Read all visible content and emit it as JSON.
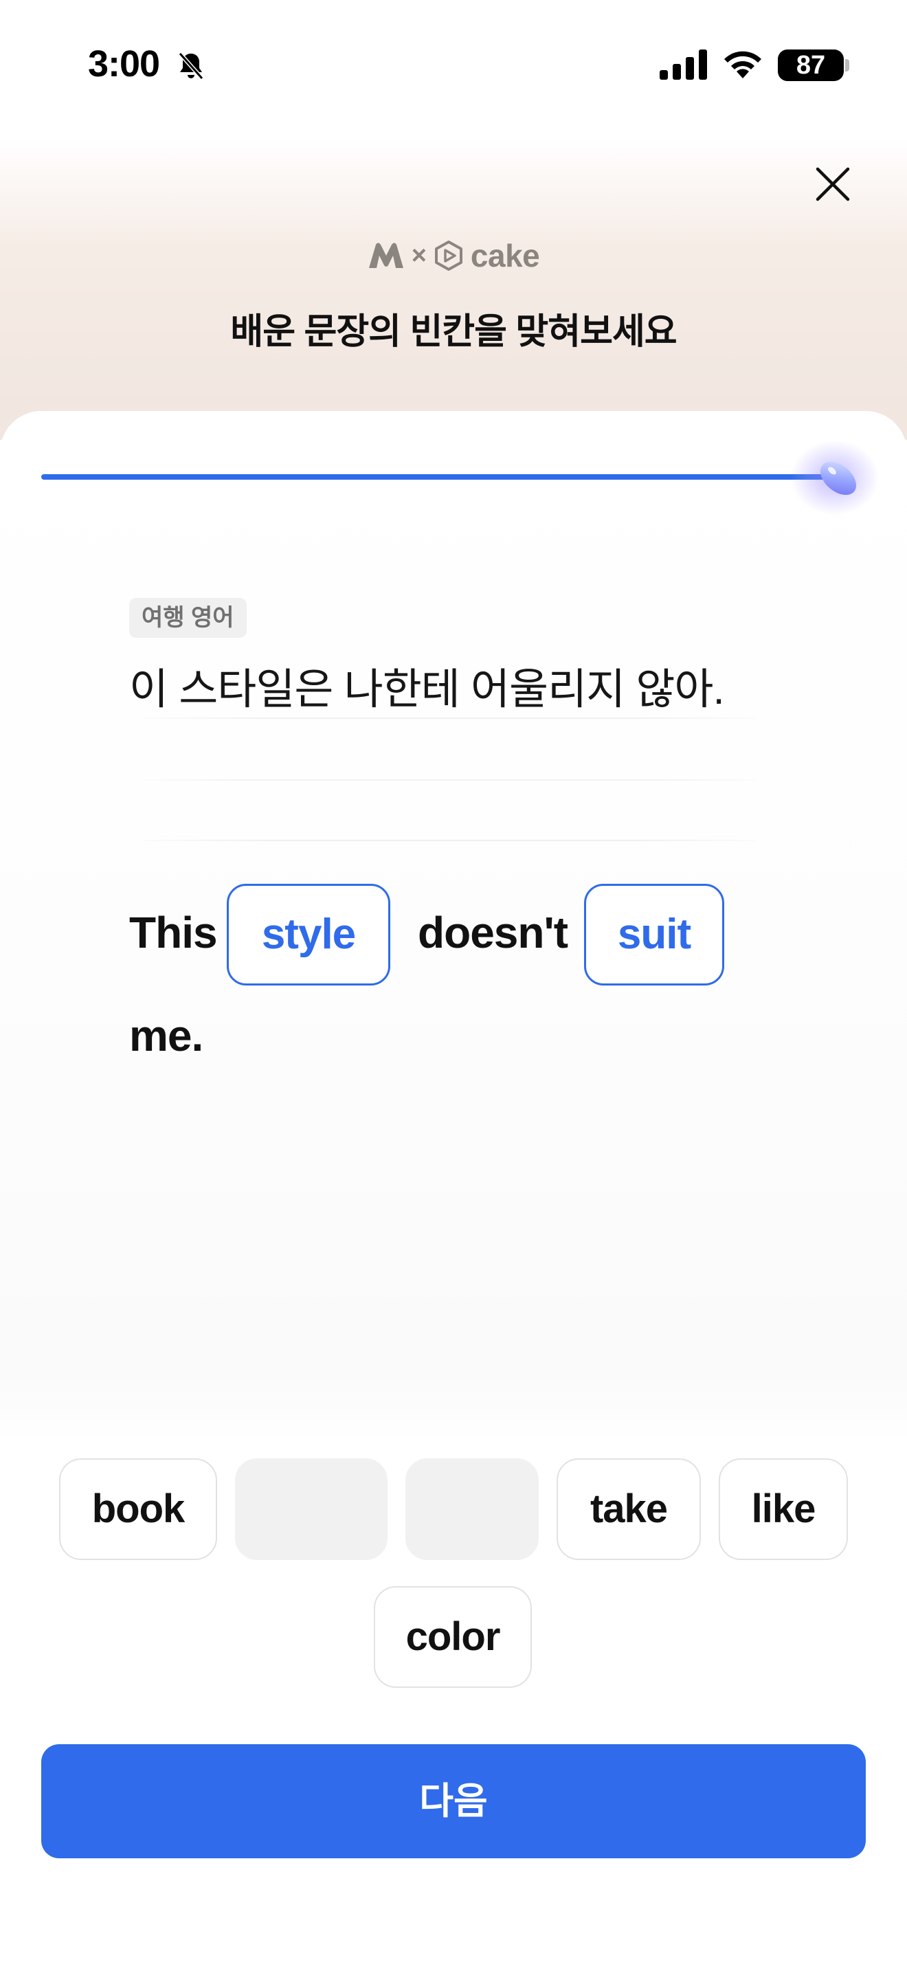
{
  "status_bar": {
    "time": "3:00",
    "battery": "87"
  },
  "header": {
    "brand_separator": "×",
    "brand_cake": "cake",
    "title": "배운 문장의 빈칸을 맞혀보세요"
  },
  "progress": {
    "value": 1.0
  },
  "question": {
    "category": "여행 영어",
    "prompt": "이 스타일은 나한테 어울리지 않아."
  },
  "sentence": {
    "word1": "This",
    "blank1": "style",
    "word2": "doesn't",
    "blank2": "suit",
    "word3": "me."
  },
  "choices": [
    {
      "label": "book",
      "used": false
    },
    {
      "label": "",
      "used": true
    },
    {
      "label": "",
      "used": true
    },
    {
      "label": "take",
      "used": false
    },
    {
      "label": "like",
      "used": false
    },
    {
      "label": "color",
      "used": false
    }
  ],
  "footer": {
    "next_label": "다음"
  },
  "colors": {
    "accent": "#2f6bea",
    "brand_gray": "#8b857f",
    "header_tint": "#f1e6e0"
  }
}
